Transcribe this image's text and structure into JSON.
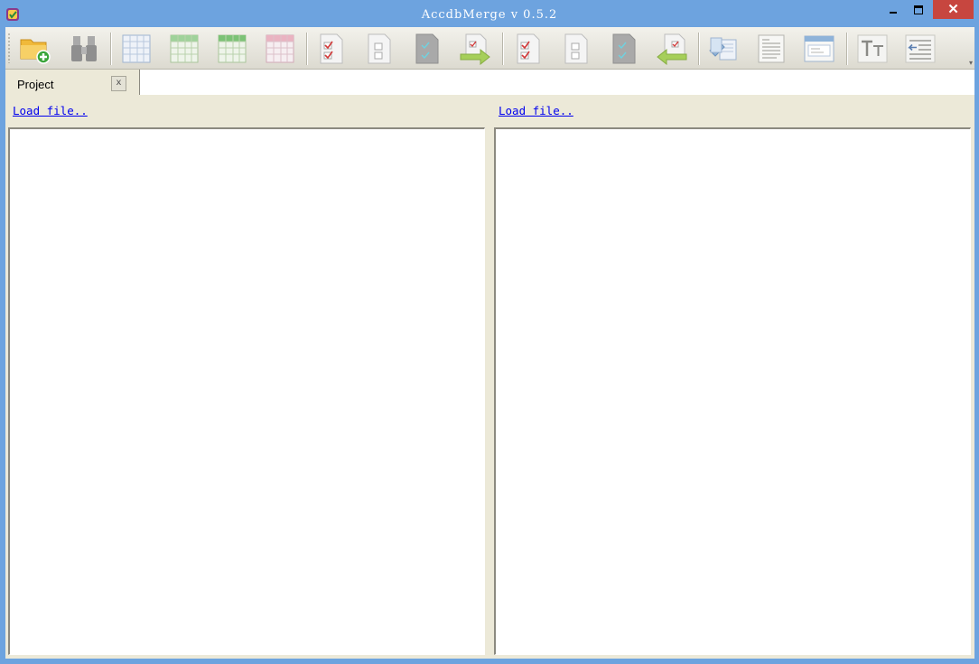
{
  "window": {
    "title": "AccdbMerge v 0.5.2",
    "close_glyph": "✕"
  },
  "toolbar": {
    "buttons": [
      "open-project",
      "find",
      "table-compare",
      "table-green",
      "table-green-2",
      "table-red",
      "doc-checked",
      "doc-boxes",
      "doc-gray",
      "doc-arrow-right",
      "doc-checked-2",
      "doc-boxes-2",
      "doc-gray-2",
      "doc-arrow-left",
      "copy-docs",
      "text-doc",
      "form-doc",
      "font-size",
      "indent"
    ]
  },
  "tabs": [
    {
      "label": "Project",
      "close_label": "x"
    }
  ],
  "left_pane": {
    "load_label": "Load file.."
  },
  "right_pane": {
    "load_label": "Load file.."
  }
}
